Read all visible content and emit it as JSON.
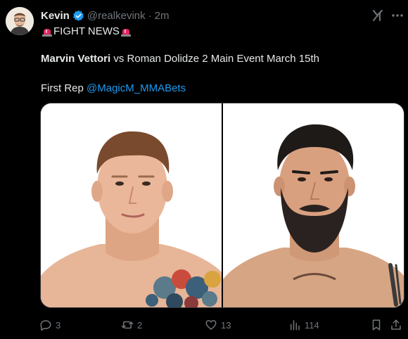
{
  "author": {
    "name": "Kevin",
    "handle": "@realkevink",
    "separator": "·",
    "time": "2m"
  },
  "tweet": {
    "headline": "FIGHT NEWS",
    "bold_name": "Marvin Vettori",
    "rest_of_line": "vs Roman Dolidze 2 Main Event March 15th",
    "first_rep_label": "First Rep",
    "mention": "@MagicM_MMABets"
  },
  "actions": {
    "replies": "3",
    "reposts": "2",
    "likes": "13",
    "views": "114"
  },
  "colors": {
    "background": "#000000",
    "text": "#e7e9ea",
    "secondary": "#71767b",
    "link": "#1d9bf0",
    "siren": "#e0245e"
  }
}
